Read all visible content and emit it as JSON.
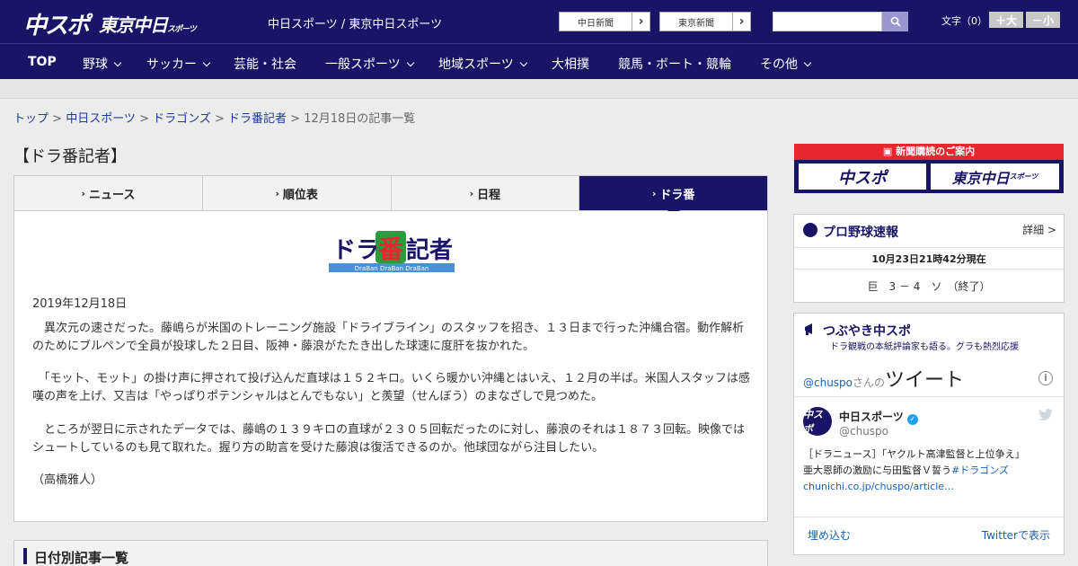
{
  "header": {
    "logo_chuspo": "中スポ",
    "logo_tokyo": "東京中日",
    "logo_tokyo_small": "スポーツ",
    "site_title": "中日スポーツ / 東京中日スポーツ",
    "link_chunichi": "中日新聞",
    "link_tokyo": "東京新聞",
    "search_placeholder": "",
    "font_label": "文字（0）",
    "font_bigger": "＋大",
    "font_smaller": "－小"
  },
  "nav": {
    "items": [
      {
        "label": "TOP"
      },
      {
        "label": "野球"
      },
      {
        "label": "サッカー"
      },
      {
        "label": "芸能・社会"
      },
      {
        "label": "一般スポーツ"
      },
      {
        "label": "地域スポーツ"
      },
      {
        "label": "大相撲"
      },
      {
        "label": "競馬・ボート・競輪"
      },
      {
        "label": "その他"
      }
    ]
  },
  "breadcrumb": {
    "items": [
      "トップ",
      "中日スポーツ",
      "ドラゴンズ",
      "ドラ番記者"
    ],
    "current": "12月18日の記事一覧",
    "sep": " > "
  },
  "page_title": "【ドラ番記者】",
  "tabs": [
    {
      "label": "ニュース"
    },
    {
      "label": "順位表"
    },
    {
      "label": "日程"
    },
    {
      "label": "ドラ番"
    }
  ],
  "article": {
    "logo_text_a": "ドラ",
    "logo_text_b": "番",
    "logo_text_c": "記者",
    "logo_sub": "DraBan DraBan DraBan",
    "date": "2019年12月18日",
    "paragraphs": [
      "　異次元の速さだった。藤嶋らが米国のトレーニング施設「ドライブライン」のスタッフを招き、１３日まで行った沖縄合宿。動作解析のためにブルペンで全員が投球した２日目、阪神・藤浪がたたき出した球速に度肝を抜かれた。",
      "　「モット、モット」の掛け声に押されて投げ込んだ直球は１５２キロ。いくら暖かい沖縄とはいえ、１２月の半ば。米国人スタッフは感嘆の声を上げ、又吉は「やっぱりポテンシャルはとんでもない」と羨望（せんぼう）のまなざしで見つめた。",
      "　ところが翌日に示されたデータでは、藤嶋の１３９キロの直球が２３０５回転だったのに対し、藤浪のそれは１８７３回転。映像ではシュートしているのも見て取れた。握り方の助言を受けた藤浪は復活できるのか。他球団ながら注目したい。",
      "（高橋雅人）"
    ]
  },
  "datelist": {
    "title": "日付別記事一覧"
  },
  "promo": {
    "title": "新聞購読のご案内",
    "left": "中スポ",
    "right": "東京中日",
    "right_small": "スポーツ"
  },
  "baseball": {
    "title": "プロ野球速報",
    "more": "詳細 >",
    "time": "10月23日21時42分現在",
    "score": "巨　3 － 4　ソ　（終了）"
  },
  "twitter": {
    "title": "つぶやき中スポ",
    "subtitle": "ドラ観戦の本紙評論家も語る。グラも熱烈応援",
    "handle_link": "@chuspo",
    "san": "さんの",
    "tweet_word": "ツイート",
    "avatar": "中スポ",
    "name": "中日スポーツ",
    "handle": "@chuspo",
    "text_1": "［ドラニュース］「ヤクルト高津監督と上位争え」",
    "text_2": "亜大恩師の激励に与田監督Ｖ誓う",
    "hashtag": "#ドラゴンズ",
    "link": "chunichi.co.jp/chuspo/article…",
    "embed": "埋め込む",
    "view_on": "Twitterで表示"
  },
  "colors": {
    "brand_navy": "#1a1466",
    "accent_red": "#e8262e",
    "link_blue": "#1a3b9a"
  }
}
